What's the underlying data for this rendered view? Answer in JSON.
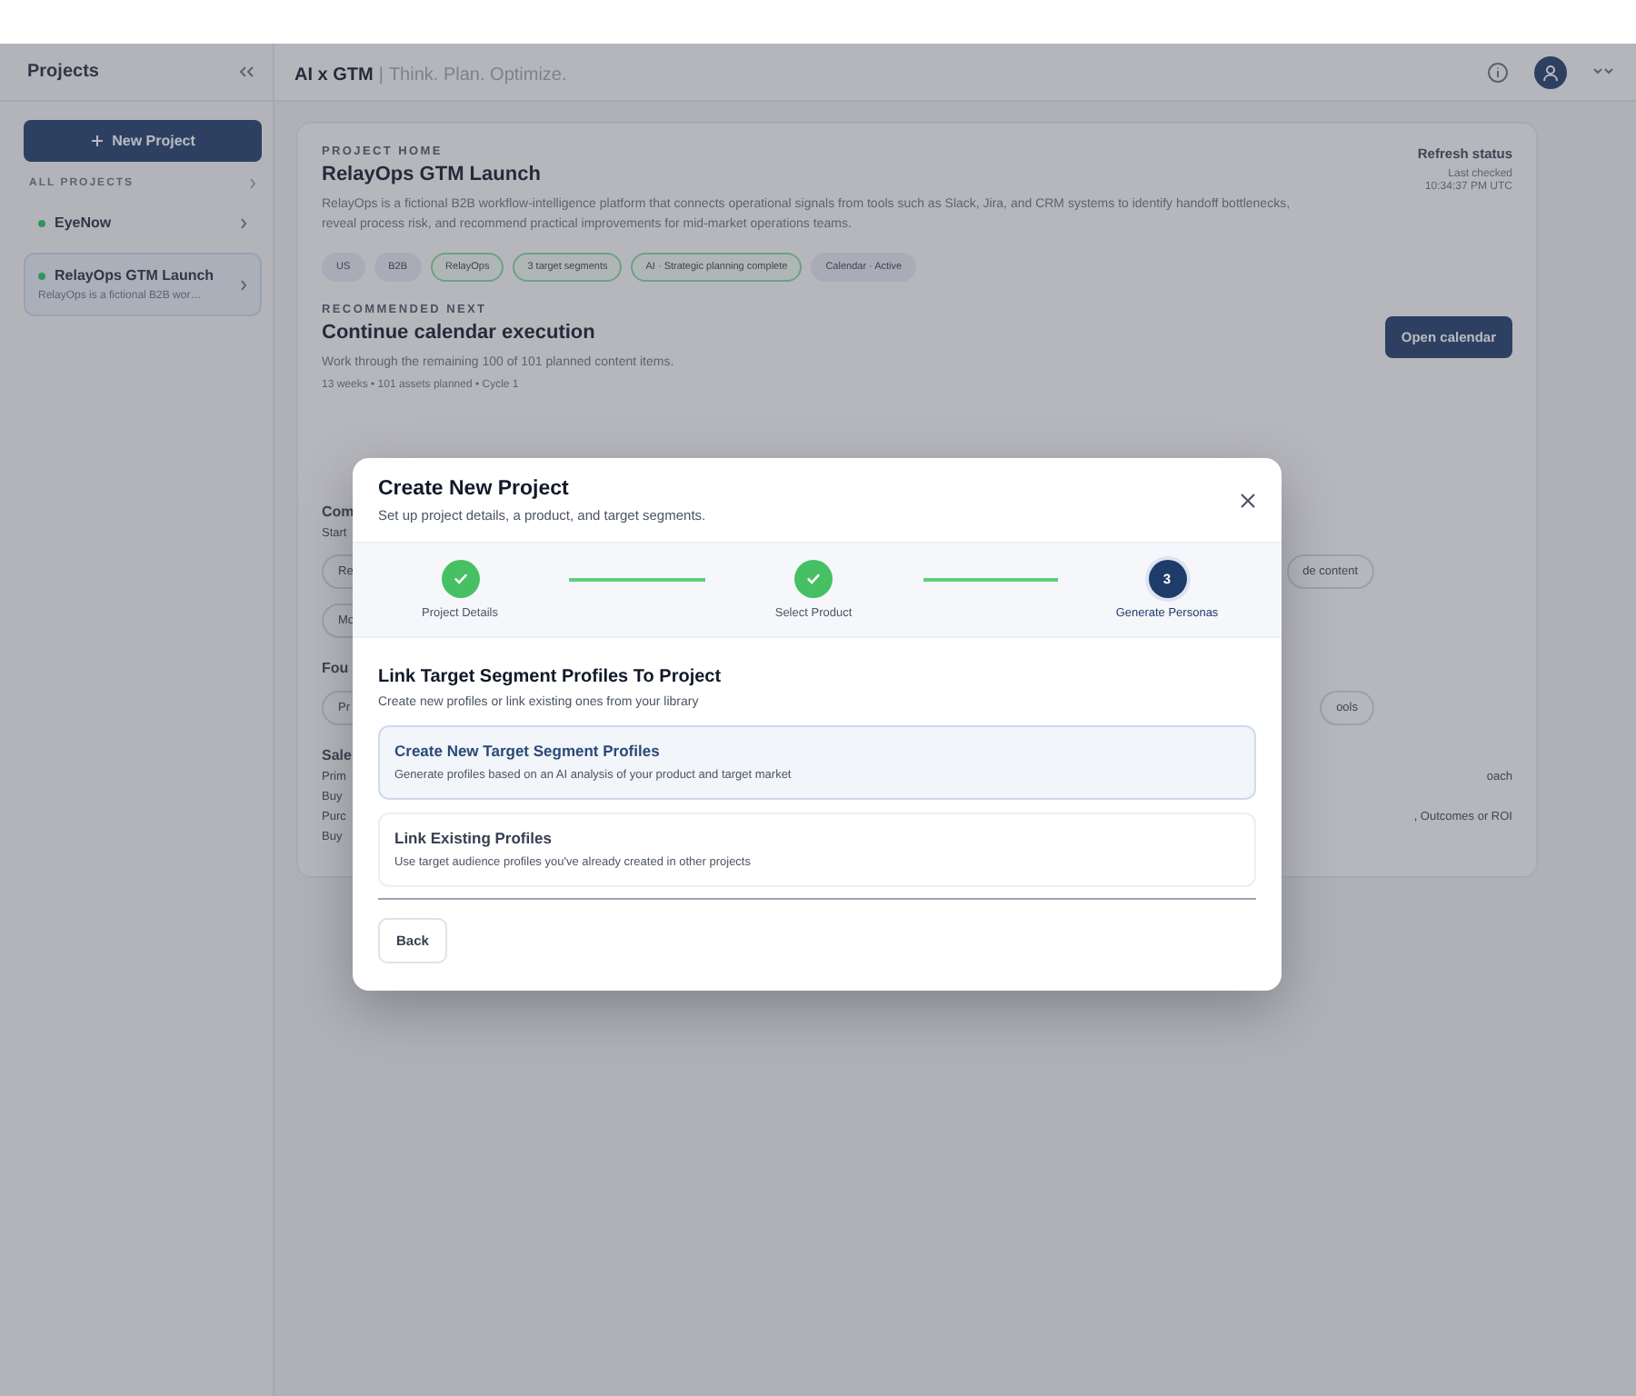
{
  "sidebar": {
    "title": "Projects",
    "new_button": "New Project",
    "section_label": "ALL PROJECTS",
    "projects": [
      {
        "name": "EyeNow",
        "selected": false
      },
      {
        "name": "RelayOps GTM Launch",
        "description": "RelayOps is a fictional B2B wor…",
        "selected": true
      }
    ]
  },
  "header": {
    "brand": "AI x GTM",
    "separator": "|",
    "tagline": "Think. Plan. Optimize."
  },
  "project": {
    "eyebrow": "PROJECT HOME",
    "title": "RelayOps GTM Launch",
    "description": "RelayOps is a fictional B2B workflow-intelligence platform that connects operational signals from tools such as Slack, Jira, and CRM systems to identify handoff bottlenecks, reveal process risk, and recommend practical improvements for mid-market operations teams.",
    "refresh_label": "Refresh status",
    "last_checked": "Last checked",
    "time": "10:34:37 PM UTC",
    "tags": [
      {
        "label": "US",
        "kind": "neutral"
      },
      {
        "label": "B2B",
        "kind": "neutral"
      },
      {
        "label": "RelayOps",
        "kind": "green"
      },
      {
        "label": "3 target segments",
        "kind": "green"
      },
      {
        "label": "AI · Strategic planning complete",
        "kind": "green"
      },
      {
        "label": "Calendar · Active",
        "kind": "neutral"
      }
    ],
    "recommended_label": "RECOMMENDED NEXT",
    "recommended_title": "Continue calendar execution",
    "recommended_text": "Work through the remaining 100 of 101 planned content items.",
    "recommended_meta": "13 weeks • 101 assets planned • Cycle 1",
    "open_calendar": "Open calendar",
    "hidden_rows": [
      {
        "kind": "heading",
        "left": "Com"
      },
      {
        "kind": "text",
        "left": "Start"
      },
      {
        "kind": "pill",
        "left": "Re",
        "right": "de content"
      },
      {
        "kind": "pill",
        "left": "Mo"
      },
      {
        "kind": "heading",
        "left": "Fou"
      },
      {
        "kind": "pill",
        "left": "Pr",
        "right": "ools"
      },
      {
        "kind": "heading",
        "left": "Sale"
      },
      {
        "kind": "text",
        "left": "Prim",
        "right": "oach"
      },
      {
        "kind": "text",
        "left": "Buy"
      },
      {
        "kind": "text",
        "left": "Purc",
        "right": ", Outcomes or ROI"
      },
      {
        "kind": "text",
        "left": "Buy"
      }
    ]
  },
  "modal": {
    "title": "Create New Project",
    "subtitle": "Set up project details, a product, and target segments.",
    "steps": [
      {
        "label": "Project Details",
        "completed": true,
        "selected": false
      },
      {
        "label": "Select Product",
        "completed": true,
        "selected": false
      },
      {
        "label": "Generate Personas",
        "completed": false,
        "selected": true,
        "number": "3"
      }
    ],
    "section_title": "Link Target Segment Profiles To Project",
    "section_subtitle": "Create new profiles or link existing ones from your library",
    "options": [
      {
        "title": "Create New Target Segment Profiles",
        "description": "Generate profiles based on an AI analysis of your product and target market",
        "selected": true
      },
      {
        "title": "Link Existing Profiles",
        "description": "Use target audience profiles you've already created in other projects",
        "selected": false
      }
    ],
    "back_button": "Back"
  }
}
